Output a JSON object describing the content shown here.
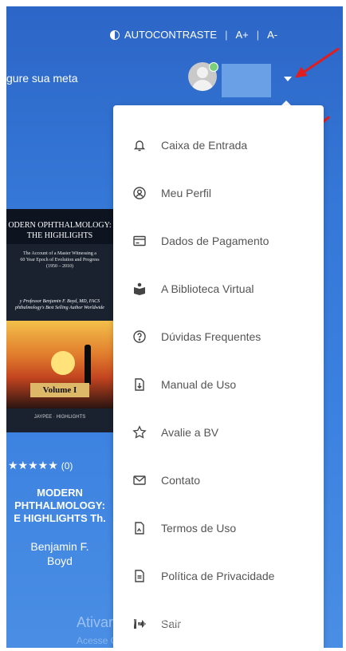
{
  "header": {
    "contrast_label": "AUTOCONTRASTE",
    "font_increase": "A+",
    "font_decrease": "A-",
    "goal_text": "gure sua meta"
  },
  "user": {
    "status_color": "#7ad07a",
    "name_redacted_color": "#6aa0e6"
  },
  "annotations": {
    "arrow_color": "#e21d1d"
  },
  "left_panel": {
    "book_cover": {
      "title_line1": "ODERN OPHTHALMOLOGY:",
      "title_line2": "THE HIGHLIGHTS",
      "subtitle_line1": "The Account of a Master Witnessing a",
      "subtitle_line2": "60 Year Epoch of Evolution and Progress",
      "subtitle_line3": "(1950 – 2010)",
      "author_line1": "y Professor Benjamin F. Boyd, MD, FACS",
      "author_line2": "phthalmology's Best Selling Author Worldwide",
      "volume": "Volume I",
      "publisher": "JAYPEE · HIGHLIGHTS"
    },
    "rating_stars": "★★★★★",
    "rating_count": "(0)",
    "title_line1": "MODERN",
    "title_line2": "PHTHALMOLOGY:",
    "title_line3": "E HIGHLIGHTS Th.",
    "author_line1": "Benjamin F.",
    "author_line2": "Boyd"
  },
  "menu": {
    "items": [
      {
        "label": "Caixa de Entrada",
        "icon": "bell-icon"
      },
      {
        "label": "Meu Perfil",
        "icon": "user-circle-icon"
      },
      {
        "label": "Dados de Pagamento",
        "icon": "credit-card-icon"
      },
      {
        "label": "A Biblioteca Virtual",
        "icon": "reader-icon"
      },
      {
        "label": "Dúvidas Frequentes",
        "icon": "question-circle-icon"
      },
      {
        "label": "Manual de Uso",
        "icon": "download-file-icon"
      },
      {
        "label": "Avalie a BV",
        "icon": "star-outline-icon"
      },
      {
        "label": "Contato",
        "icon": "envelope-icon"
      },
      {
        "label": "Termos de Uso",
        "icon": "document-icon"
      },
      {
        "label": "Política de Privacidade",
        "icon": "file-text-icon"
      },
      {
        "label": "Sair",
        "icon": "sign-out-icon"
      }
    ]
  },
  "watermark": {
    "line1": "Ativar o Windows",
    "line2": "Acesse Configurações para ativar o Windows"
  }
}
